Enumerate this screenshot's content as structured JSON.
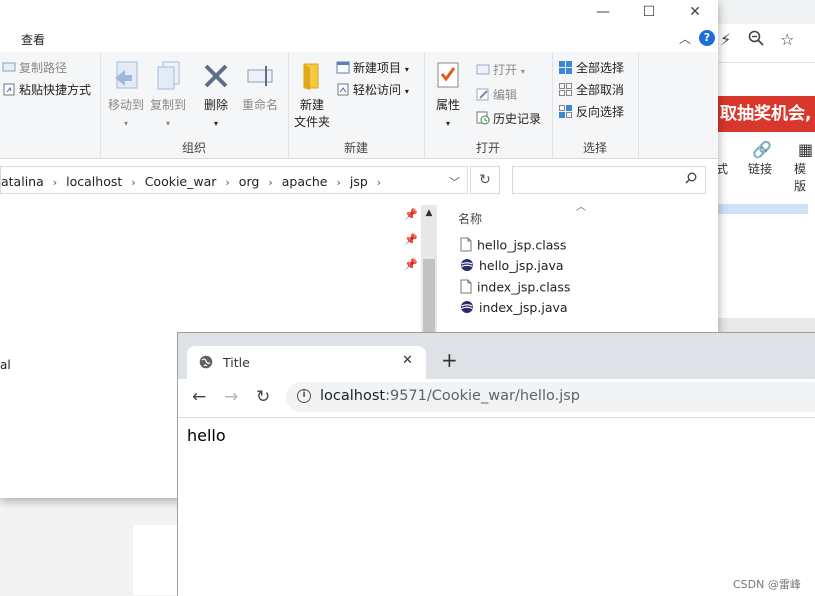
{
  "explorer": {
    "menu": {
      "view": "查看"
    },
    "ribbon": {
      "clipboard": {
        "copy_path": "复制路径",
        "paste_shortcut": "粘贴快捷方式"
      },
      "organize": {
        "label": "组织",
        "move_to": "移动到",
        "copy_to": "复制到",
        "delete": "删除",
        "rename": "重命名"
      },
      "new": {
        "label": "新建",
        "new_folder_line1": "新建",
        "new_folder_line2": "文件夹",
        "new_item": "新建项目",
        "easy_access": "轻松访问"
      },
      "open": {
        "label": "打开",
        "properties": "属性",
        "open": "打开",
        "edit": "编辑",
        "history": "历史记录"
      },
      "select": {
        "label": "选择",
        "select_all": "全部选择",
        "select_none": "全部取消",
        "invert": "反向选择"
      }
    },
    "address": {
      "crumbs": [
        "atalina",
        "localhost",
        "Cookie_war",
        "org",
        "apache",
        "jsp"
      ]
    },
    "nav_pane": {
      "cut_text": "al"
    },
    "file_list": {
      "column_name": "名称",
      "files": [
        {
          "name": "hello_jsp.class",
          "icon": "file-icon"
        },
        {
          "name": "hello_jsp.java",
          "icon": "java-file-icon"
        },
        {
          "name": "index_jsp.class",
          "icon": "file-icon"
        },
        {
          "name": "index_jsp.java",
          "icon": "java-file-icon"
        }
      ]
    }
  },
  "bg_browser": {
    "banner": "取抽奖机会,",
    "tools": {
      "style_cut": "式",
      "link": "链接",
      "template_cut": "模版"
    }
  },
  "browser": {
    "tab_title": "Title",
    "url_host": "localhost",
    "url_rest": ":9571/Cookie_war/hello.jsp",
    "page_text": "hello"
  },
  "watermark": "CSDN @雷峰",
  "colors": {
    "help_blue": "#1d6fd6",
    "banner_red": "#d8382b",
    "tabstrip": "#dee1e6"
  }
}
